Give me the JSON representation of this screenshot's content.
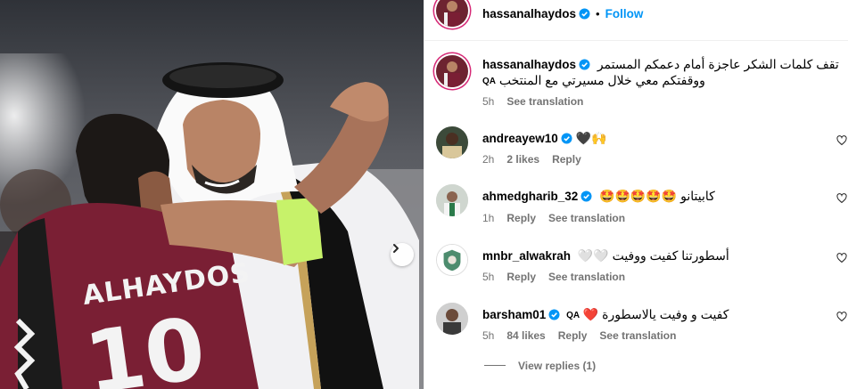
{
  "post": {
    "author": "hassanalhaydos",
    "follow_label": "Follow",
    "dot": "•",
    "jersey_name": "ALHAYDOS",
    "jersey_number": "10"
  },
  "caption": {
    "username": "hassanalhaydos",
    "text_line1": "تقف كلمات الشكر عاجزة أمام دعمكم المستمر",
    "text_line2": "ووقفتكم معي خلال مسيرتي مع المنتخب",
    "flag": "QA",
    "time": "5h",
    "see_translation": "See translation"
  },
  "comments": [
    {
      "username": "andreayew10",
      "verified": true,
      "text": "🖤🙌",
      "time": "2h",
      "likes": "2 likes",
      "reply": "Reply",
      "see_translation": ""
    },
    {
      "username": "ahmedgharib_32",
      "verified": true,
      "text": "كابيتانو 🤩🤩🤩🤩🤩",
      "time": "1h",
      "likes": "",
      "reply": "Reply",
      "see_translation": "See translation"
    },
    {
      "username": "mnbr_alwakrah",
      "verified": false,
      "text": "أسطورتنا كفيت ووفيت 🤍🤍",
      "time": "5h",
      "likes": "",
      "reply": "Reply",
      "see_translation": "See translation"
    },
    {
      "username": "barsham01",
      "verified": true,
      "flag": "QA",
      "text": "كفيت و وفيت يالاسطورة ❤️",
      "time": "5h",
      "likes": "84 likes",
      "reply": "Reply",
      "see_translation": "See translation"
    }
  ],
  "view_replies": "View replies (1)",
  "icons": {
    "verified": "verified-badge-icon",
    "next": "chevron-right-icon",
    "like": "heart-outline-icon"
  },
  "colors": {
    "accent": "#0095f6",
    "muted": "#737373",
    "jersey": "#7a1f34",
    "armband": "#c7f26a"
  }
}
